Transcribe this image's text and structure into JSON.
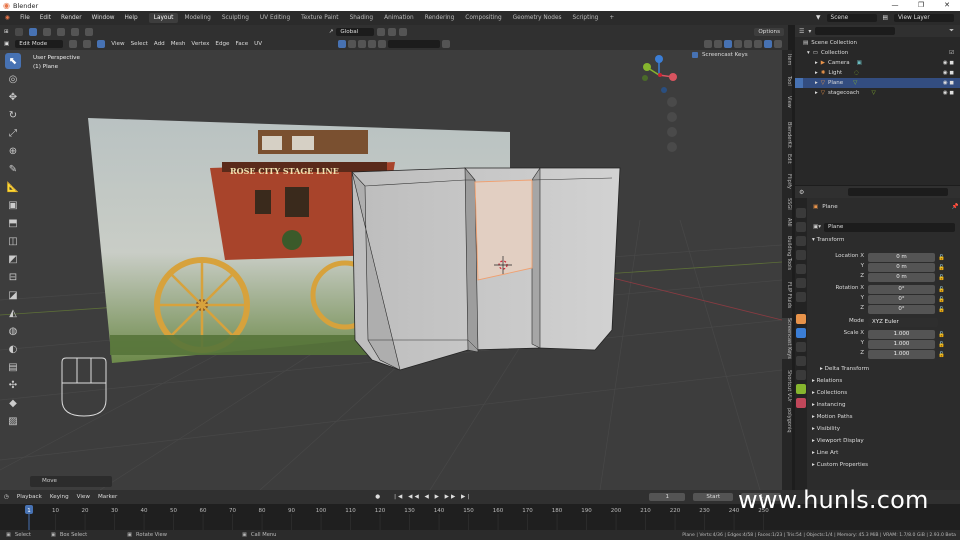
{
  "window": {
    "title": "Blender",
    "controls": [
      "—",
      "❐",
      "✕"
    ]
  },
  "menubar": {
    "menus": [
      "File",
      "Edit",
      "Render",
      "Window",
      "Help"
    ],
    "workspaces": [
      "Layout",
      "Modeling",
      "Sculpting",
      "UV Editing",
      "Texture Paint",
      "Shading",
      "Animation",
      "Rendering",
      "Compositing",
      "Geometry Nodes",
      "Scripting"
    ],
    "active_workspace": "Layout",
    "add_workspace": "+",
    "scene": "Scene",
    "view_layer": "View Layer"
  },
  "viewport_header": {
    "mode": "Edit Mode",
    "menus": [
      "View",
      "Select",
      "Add",
      "Mesh",
      "Vertex",
      "Edge",
      "Face",
      "UV"
    ],
    "transform_orientation": "Global",
    "options": "Options",
    "overlay_label": "Screencast Keys"
  },
  "viewport": {
    "perspective": "User Perspective",
    "object": "(1) Plane",
    "operator_panel": "Move",
    "image_sign": "ROSE CITY STAGE LINE"
  },
  "side_tabs": [
    "Item",
    "Tool",
    "View",
    "BlenderKit",
    "Edit",
    "Flipify",
    "SSGI",
    "ANI",
    "Building Tools",
    "FLIP Fluids",
    "Screencast Keys",
    "Shortcut VUr",
    "polygoniq"
  ],
  "outliner": {
    "root": "Scene Collection",
    "collection": "Collection",
    "items": [
      {
        "name": "Camera",
        "color": "#e8934a"
      },
      {
        "name": "Light",
        "color": "#e8934a"
      },
      {
        "name": "Plane",
        "color": "#e8934a",
        "selected": true
      },
      {
        "name": "stagecoach",
        "color": "#e8934a"
      }
    ]
  },
  "properties": {
    "object_name": "Plane",
    "data_name": "Plane",
    "section": "Transform",
    "location": {
      "label": "Location X",
      "y": "Y",
      "z": "Z",
      "values": [
        "0 m",
        "0 m",
        "0 m"
      ]
    },
    "rotation": {
      "label": "Rotation X",
      "y": "Y",
      "z": "Z",
      "values": [
        "0°",
        "0°",
        "0°"
      ]
    },
    "mode_label": "Mode",
    "mode_value": "XYZ Euler",
    "scale": {
      "label": "Scale X",
      "y": "Y",
      "z": "Z",
      "values": [
        "1.000",
        "1.000",
        "1.000"
      ]
    },
    "subsections": [
      "Delta Transform",
      "Relations",
      "Collections",
      "Instancing",
      "Motion Paths",
      "Visibility",
      "Viewport Display",
      "Line Art",
      "Custom Properties"
    ]
  },
  "timeline": {
    "menus": [
      "Playback",
      "Keying",
      "View",
      "Marker"
    ],
    "current_frame": "1",
    "start_label": "Start",
    "start_value": "1",
    "ticks": [
      "1",
      "10",
      "20",
      "30",
      "40",
      "50",
      "60",
      "70",
      "80",
      "90",
      "100",
      "110",
      "120",
      "130",
      "140",
      "150",
      "160",
      "170",
      "180",
      "190",
      "200",
      "210",
      "220",
      "230",
      "240",
      "250"
    ]
  },
  "statusbar": {
    "left": [
      "Select",
      "Box Select",
      "Rotate View",
      "Call Menu"
    ],
    "right": "Plane | Verts:4/36 | Edges:4/58 | Faces:1/23 | Tris:54 | Objects:1/4 | Memory: 45.3 MiB | VRAM: 1.7/8.0 GiB | 2.93.0 Beta"
  },
  "watermark": "www.hunls.com",
  "colors": {
    "accent": "#4772b3",
    "selected_row": "#334d80",
    "x_axis": "#d8545f",
    "y_axis": "#86b52e",
    "z_axis": "#3b7ed6"
  }
}
